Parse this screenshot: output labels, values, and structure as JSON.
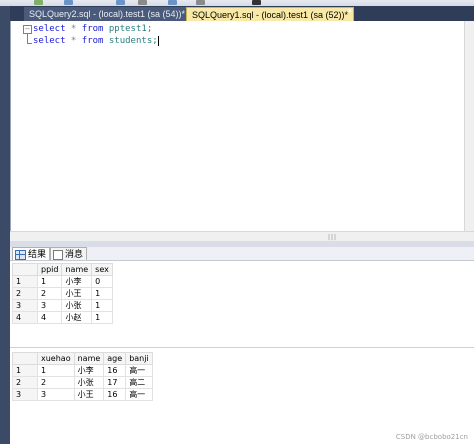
{
  "tabs": {
    "inactive_label": "SQLQuery2.sql - (local).test1 (sa (54))*",
    "active_label": "SQLQuery1.sql - (local).test1 (sa (52))*",
    "dropdown_glyph": "▾"
  },
  "editor": {
    "collapse_glyph": "−",
    "lines": [
      {
        "kw1": "select",
        "op": " * ",
        "kw2": "from",
        "table": " pptest1;"
      },
      {
        "kw1": "select",
        "op": " * ",
        "kw2": "from",
        "table": " students;"
      }
    ]
  },
  "results_tabs": {
    "results_label": "结果",
    "messages_label": "消息"
  },
  "grid1": {
    "columns": [
      "ppid",
      "name",
      "sex"
    ],
    "rows": [
      {
        "rn": "1",
        "cells": [
          "1",
          "小李",
          "0"
        ]
      },
      {
        "rn": "2",
        "cells": [
          "2",
          "小王",
          "1"
        ]
      },
      {
        "rn": "3",
        "cells": [
          "3",
          "小张",
          "1"
        ]
      },
      {
        "rn": "4",
        "cells": [
          "4",
          "小赵",
          "1"
        ]
      }
    ]
  },
  "grid2": {
    "columns": [
      "xuehao",
      "name",
      "age",
      "banji"
    ],
    "rows": [
      {
        "rn": "1",
        "cells": [
          "1",
          "小李",
          "16",
          "高一"
        ]
      },
      {
        "rn": "2",
        "cells": [
          "2",
          "小张",
          "17",
          "高二"
        ]
      },
      {
        "rn": "3",
        "cells": [
          "3",
          "小王",
          "16",
          "高一"
        ]
      }
    ]
  },
  "watermark": "CSDN @bcbobo21cn",
  "colors": {
    "tab_active_bg": "#f8e9a7",
    "tab_strip_bg": "#2f3d59",
    "keyword": "#1b1bd6",
    "identifier": "#2a8080"
  }
}
